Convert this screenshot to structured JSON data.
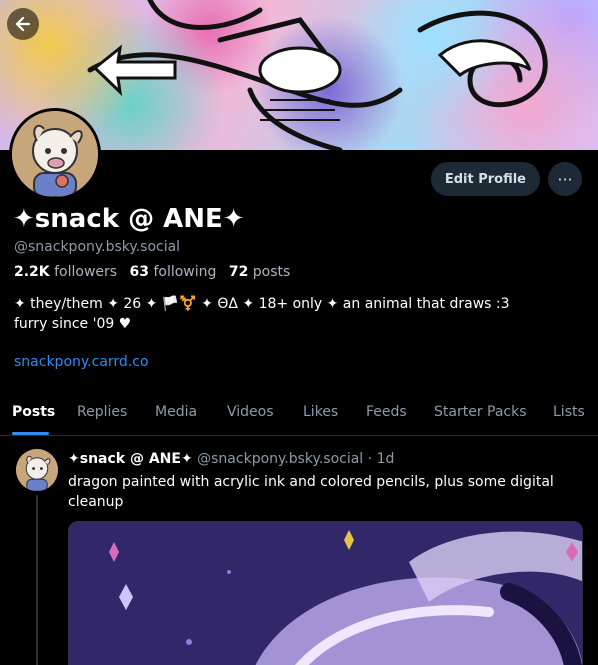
{
  "profile": {
    "display_name": "✦snack @ ANE✦",
    "handle": "@snackpony.bsky.social",
    "followers_count": "2.2K",
    "followers_label": "followers",
    "following_count": "63",
    "following_label": "following",
    "posts_count": "72",
    "posts_label": "posts",
    "bio_line1": "✦ they/them ✦ 26 ✦ 🏳️⚧️ ✦ ΘΔ ✦ 18+ only ✦ an animal that draws :3",
    "bio_line2": "furry since '09 ♥",
    "link": "snackpony.carrd.co"
  },
  "actions": {
    "edit_label": "Edit Profile",
    "more_label": "···"
  },
  "tabs": [
    "Posts",
    "Replies",
    "Media",
    "Videos",
    "Likes",
    "Feeds",
    "Starter Packs",
    "Lists"
  ],
  "active_tab": "Posts",
  "post": {
    "author_name": "✦snack @ ANE✦",
    "author_handle": "@snackpony.bsky.social",
    "separator": "·",
    "time": "1d",
    "text": "dragon painted with acrylic ink and colored pencils, plus some digital cleanup"
  },
  "colors": {
    "accent": "#2e8cf0",
    "background": "#000000",
    "muted_text": "#8c9aa9",
    "button_bg": "#1e2936"
  },
  "icons": {
    "back": "arrow-left-icon",
    "more": "ellipsis-icon"
  }
}
